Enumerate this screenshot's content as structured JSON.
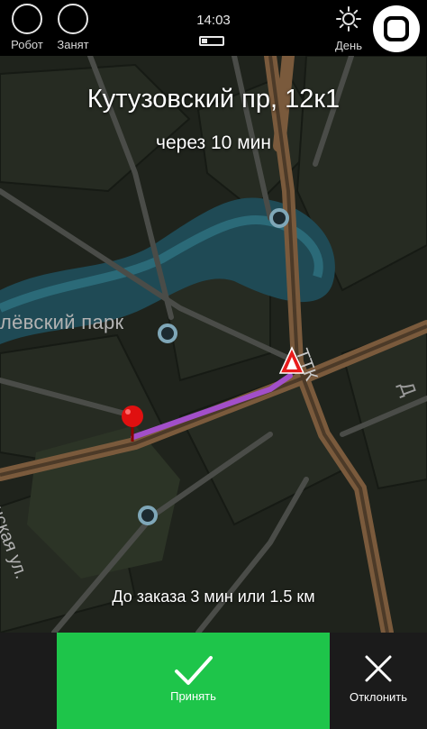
{
  "status_bar": {
    "robot_label": "Робот",
    "busy_label": "Занят",
    "time": "14:03",
    "battery_level_percent": 25,
    "day_label": "День"
  },
  "order": {
    "address": "Кутузовский пр, 12к1",
    "eta": "через 10 мин",
    "distance_info": "До заказа 3 мин или 1.5 км"
  },
  "map": {
    "labels": {
      "park": "лёвский парк",
      "street": "инская ул.",
      "ttk": "ТТК",
      "partial": "Д"
    },
    "colors": {
      "background": "#1f231c",
      "main_road": "#7a5a3c",
      "route": "#a24fc9",
      "river": "#1f4a55"
    }
  },
  "actions": {
    "accept_label": "Принять",
    "decline_label": "Отклонить",
    "accept_color": "#1ec54a"
  }
}
